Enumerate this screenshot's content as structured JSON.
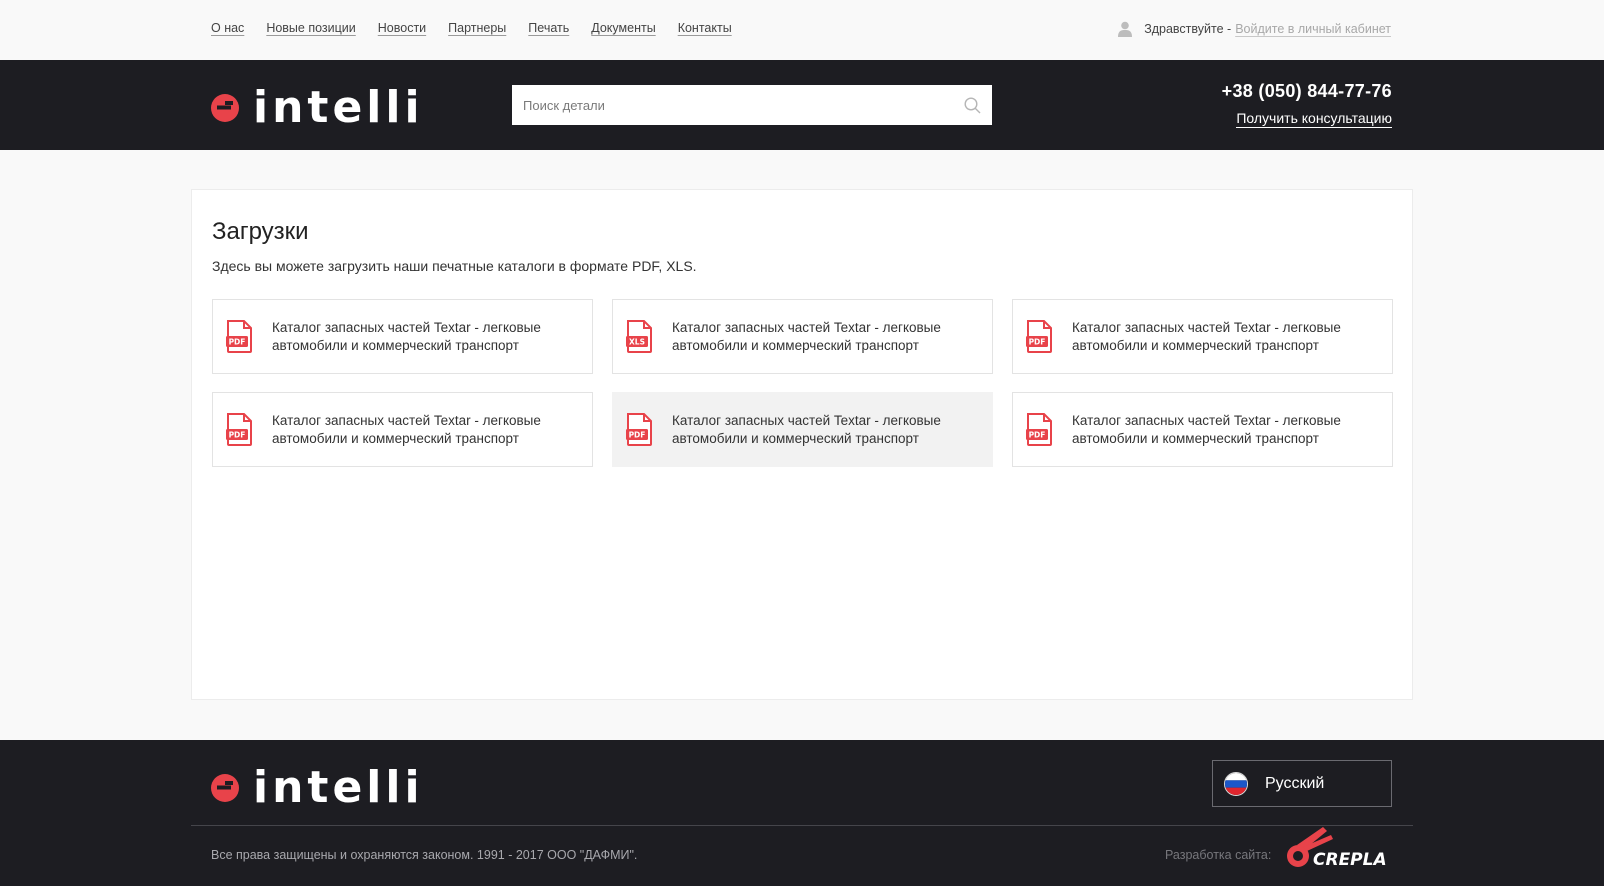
{
  "topnav": {
    "items": [
      "О нас",
      "Новые позиции",
      "Новости",
      "Партнеры",
      "Печать",
      "Документы",
      "Контакты"
    ],
    "greeting": "Здравствуйте -",
    "login_link": "Войдите в личный кабинет"
  },
  "header": {
    "logo_text": "intelli",
    "search_placeholder": "Поиск детали",
    "phone": "+38 (050) 844-77-76",
    "consult_link": "Получить консультацию"
  },
  "main": {
    "title": "Загрузки",
    "description": "Здесь вы можете загрузить наши печатные каталоги в формате PDF, XLS.",
    "files": [
      {
        "type": "PDF",
        "title": "Каталог запасных частей Textar - легковые автомобили и коммерческий транспорт"
      },
      {
        "type": "XLS",
        "title": "Каталог запасных частей Textar - легковые автомобили и коммерческий транспорт"
      },
      {
        "type": "PDF",
        "title": "Каталог запасных частей Textar - легковые автомобили и коммерческий транспорт"
      },
      {
        "type": "PDF",
        "title": "Каталог запасных частей Textar - легковые автомобили и коммерческий транспорт"
      },
      {
        "type": "PDF",
        "title": "Каталог запасных частей Textar - легковые автомобили и коммерческий транспорт",
        "active": true
      },
      {
        "type": "PDF",
        "title": "Каталог запасных частей Textar - легковые автомобили и коммерческий транспорт"
      }
    ]
  },
  "footer": {
    "language": "Русский",
    "copyright": "Все права защищены и охраняются законом. 1991 - 2017 ООО \"ДАФМИ\".",
    "dev_label": "Разработка сайта:",
    "dev_logo_text": "CREPLA"
  },
  "colors": {
    "accent": "#e8434a",
    "header_bg": "#1d1d22",
    "page_bg": "#f9f9f9"
  },
  "icons": [
    "user-icon",
    "search-icon",
    "pdf-file-icon",
    "xls-file-icon",
    "russia-flag-icon"
  ]
}
